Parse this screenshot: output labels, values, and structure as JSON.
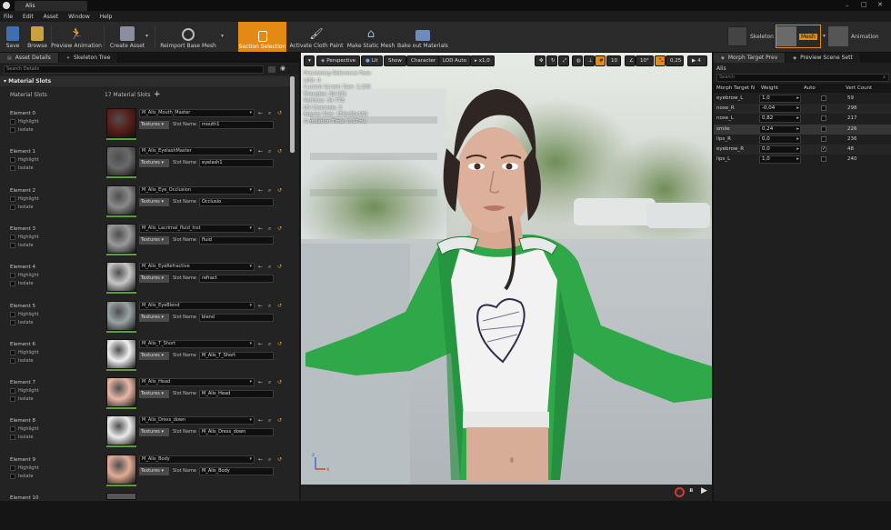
{
  "window": {
    "title": "Alis"
  },
  "menu": [
    "File",
    "Edit",
    "Asset",
    "Window",
    "Help"
  ],
  "toolbar": {
    "left": [
      "Save",
      "Browse",
      "Preview Animation",
      "Create Asset",
      "Reimport Base Mesh",
      "Section Selection",
      "Activate Cloth Paint",
      "Make Static Mesh",
      "Bake out Materials"
    ],
    "modes": [
      "Skeleton",
      "Mesh",
      "Animation"
    ]
  },
  "left_panel": {
    "tabs": [
      "Asset Details",
      "Skeleton Tree"
    ],
    "search_placeholder": "Search Details",
    "category": "Material Slots",
    "slots_label": "Material Slots",
    "slots_count": "17 Material Slots",
    "add_icon": "+",
    "highlight_label": "Highlight",
    "isolate_label": "Isolate",
    "textures_label": "Textures",
    "slot_name_label": "Slot Name",
    "elements": [
      {
        "name": "Element 0",
        "material": "M_Alis_Mouth_Master",
        "slot": "mouth1"
      },
      {
        "name": "Element 1",
        "material": "M_Alis_EyelashMaster",
        "slot": "eyelash1"
      },
      {
        "name": "Element 2",
        "material": "M_Alis_Eye_Occlusion",
        "slot": "Occlusio"
      },
      {
        "name": "Element 3",
        "material": "M_Alis_Lacrimal_fluid_Inst",
        "slot": "fluid"
      },
      {
        "name": "Element 4",
        "material": "M_Alis_EyeRefractive",
        "slot": "refract"
      },
      {
        "name": "Element 5",
        "material": "M_Alis_EyeBlend",
        "slot": "blend"
      },
      {
        "name": "Element 6",
        "material": "M_Alis_T_Short",
        "slot": "M_Alis_T_Short"
      },
      {
        "name": "Element 7",
        "material": "M_Alis_Head",
        "slot": "M_Alis_Head"
      },
      {
        "name": "Element 8",
        "material": "M_Alis_Dress_down",
        "slot": "M_Alis_Dress_down"
      },
      {
        "name": "Element 9",
        "material": "M_Alis_Body",
        "slot": "M_Alis_Body"
      },
      {
        "name": "Element 10",
        "material": "",
        "slot": ""
      }
    ]
  },
  "viewport": {
    "buttons": [
      "Perspective",
      "Lit",
      "Show",
      "Character",
      "LOD Auto",
      "x1,0"
    ],
    "grid": "10",
    "angle": "10°",
    "scale": "0,25",
    "cam_speed": "4",
    "stats": [
      "Previewing Reference Pose",
      "LOD: 0",
      "Current Screen Size: 2,235",
      "Triangles: 59 021",
      "Vertices: 34 778",
      "UV Channels: 2",
      "Approx Size: 150x38x182",
      "Simulation Time: 0,17ms"
    ]
  },
  "right_panel": {
    "tabs": [
      "Morph Target Prev",
      "Preview Scene Sett"
    ],
    "asset": "Alis",
    "search_placeholder": "Search",
    "headers": [
      "Morph Target N",
      "Weight",
      "Auto",
      "Vert Count"
    ],
    "rows": [
      {
        "name": "eyebrow_L",
        "weight": "1,0",
        "auto": false,
        "verts": "59"
      },
      {
        "name": "nose_R",
        "weight": "-0,04",
        "auto": false,
        "verts": "298"
      },
      {
        "name": "nose_L",
        "weight": "0,82",
        "auto": false,
        "verts": "217"
      },
      {
        "name": "smile",
        "weight": "0,24",
        "auto": false,
        "verts": "226"
      },
      {
        "name": "lips_R",
        "weight": "0,0",
        "auto": false,
        "verts": "236"
      },
      {
        "name": "eyebrow_R",
        "weight": "0,0",
        "auto": true,
        "verts": "48"
      },
      {
        "name": "lips_L",
        "weight": "1,0",
        "auto": false,
        "verts": "240"
      }
    ]
  },
  "colors": {
    "accent": "#e38a14",
    "jacket": "#2fa84a",
    "panel": "#232323"
  }
}
